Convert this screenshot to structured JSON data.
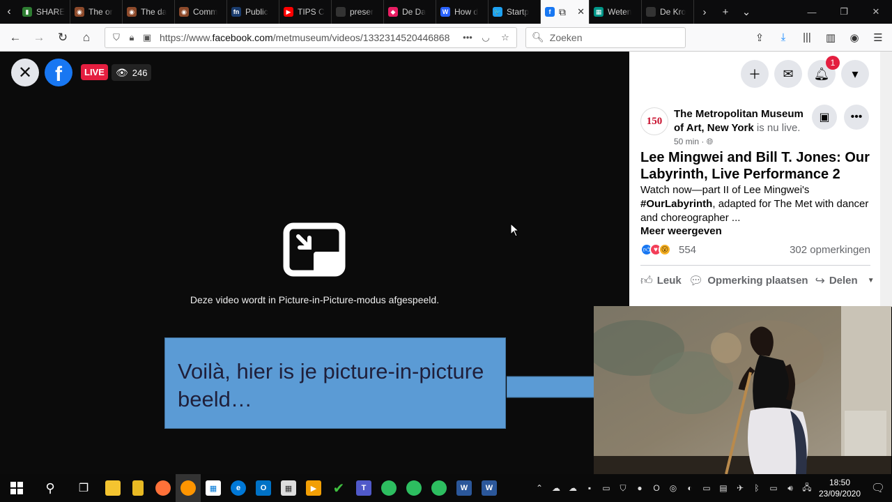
{
  "browser": {
    "tabs": [
      {
        "title": "SHARE",
        "color": "#2e7d32",
        "glyph": "▮"
      },
      {
        "title": "The or",
        "color": "#8d4a2b",
        "glyph": "◉"
      },
      {
        "title": "The da",
        "color": "#8d4a2b",
        "glyph": "◉"
      },
      {
        "title": "Comm",
        "color": "#8d4a2b",
        "glyph": "◉"
      },
      {
        "title": "Public",
        "color": "#1a3c6e",
        "glyph": "fn"
      },
      {
        "title": "TIPS C",
        "color": "#ff0000",
        "glyph": "▶"
      },
      {
        "title": "preser",
        "color": "#333333",
        "glyph": ""
      },
      {
        "title": "De Da",
        "color": "#e91e63",
        "glyph": "◆"
      },
      {
        "title": "How d",
        "color": "#2962ff",
        "glyph": "W"
      },
      {
        "title": "Startp",
        "color": "#1da1f2",
        "glyph": "🐦"
      },
      {
        "title": "",
        "color": "#1877f2",
        "glyph": "f",
        "active": true
      },
      {
        "title": "Weten",
        "color": "#009688",
        "glyph": "▦"
      },
      {
        "title": "De Kro",
        "color": "#333333",
        "glyph": ""
      }
    ],
    "url_prefix": "https://www.",
    "url_domain": "facebook.com",
    "url_path": "/metmuseum/videos/1332314520446868",
    "search_placeholder": "Zoeken"
  },
  "video": {
    "live_label": "LIVE",
    "viewer_count": "246",
    "pip_message": "Deze video wordt in Picture-in-Picture-modus afgespeeld."
  },
  "callout": {
    "text": "Voilà, hier is je picture-in-picture beeld…"
  },
  "post": {
    "notification_count": "1",
    "page_avatar_text": "150",
    "page_name": "The Metropolitan Museum of Art, New York",
    "live_status": "is nu live.",
    "time": "50 min ·",
    "title": "Lee Mingwei and Bill T. Jones: Our Labyrinth, Live Performance 2",
    "desc_1": "Watch now—part II of Lee Mingwei's",
    "hashtag": "#OurLabyrinth",
    "desc_2": ", adapted for The Met with dancer and choreographer ...",
    "see_more": "Meer weergeven",
    "reaction_count": "554",
    "comment_count": "302 opmerkingen",
    "like_label": "Leuk",
    "comment_label": "Opmerking plaatsen",
    "share_label": "Delen"
  },
  "taskbar": {
    "time": "18:50",
    "date": "23/09/2020"
  }
}
